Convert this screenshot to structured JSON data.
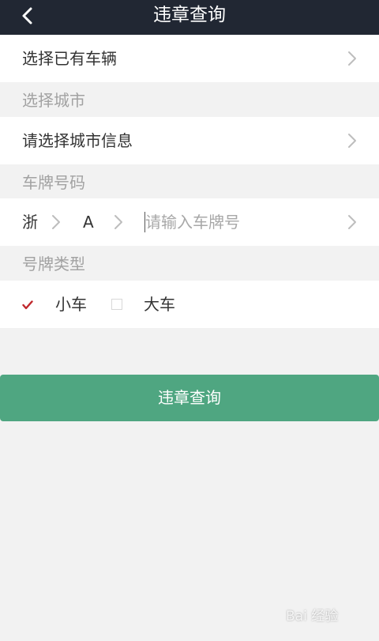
{
  "header": {
    "title": "违章查询",
    "back_icon": "chevron-left-icon"
  },
  "vehicle_select": {
    "label": "选择已有车辆"
  },
  "city_section": {
    "title": "选择城市",
    "row_label": "请选择城市信息"
  },
  "plate_section": {
    "title": "车牌号码",
    "province": "浙",
    "letter": "A",
    "input_value": "",
    "input_placeholder": "请输入车牌号"
  },
  "plate_type_section": {
    "title": "号牌类型",
    "options": [
      {
        "label": "小车",
        "checked": true
      },
      {
        "label": "大车",
        "checked": false
      }
    ]
  },
  "submit": {
    "label": "违章查询"
  },
  "watermark": {
    "text": "Bai 经验"
  },
  "colors": {
    "header_bg": "#212733",
    "page_bg": "#f2f2f2",
    "button_green": "#4fa681",
    "check_red": "#c0282d",
    "muted_text": "#a2a2a2"
  }
}
